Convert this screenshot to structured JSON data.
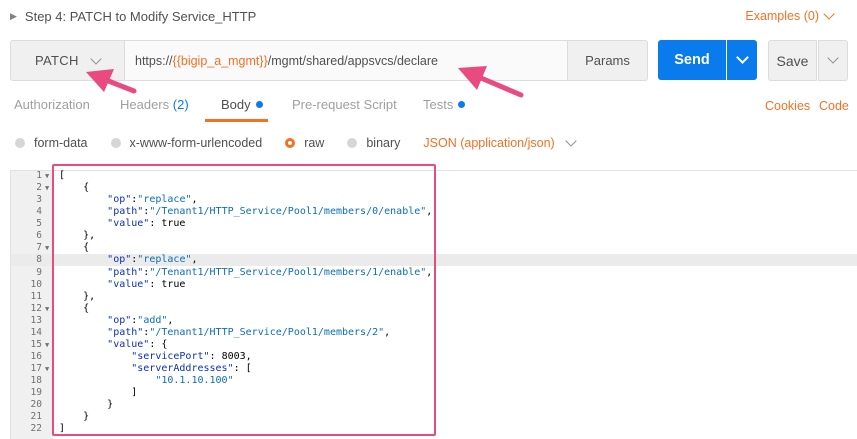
{
  "request": {
    "title": "Step 4: PATCH to Modify Service_HTTP",
    "examples_label": "Examples (0)"
  },
  "url_bar": {
    "method": "PATCH",
    "url_prefix": "https://",
    "url_variable": "{{bigip_a_mgmt}}",
    "url_suffix": "/mgmt/shared/appsvcs/declare",
    "params_label": "Params",
    "send_label": "Send",
    "save_label": "Save"
  },
  "tabs": [
    {
      "label": "Authorization"
    },
    {
      "label": "Headers",
      "count": "(2)"
    },
    {
      "label": "Body",
      "active": true
    },
    {
      "label": "Pre-request Script"
    },
    {
      "label": "Tests"
    }
  ],
  "right_links": {
    "cookies": "Cookies",
    "code": "Code"
  },
  "body_types": {
    "options": [
      "form-data",
      "x-www-form-urlencoded",
      "raw",
      "binary"
    ],
    "selected": "raw",
    "content_type": "JSON (application/json)"
  },
  "editor": {
    "line_numbers": [
      "1",
      "2",
      "3",
      "4",
      "5",
      "6",
      "7",
      "8",
      "9",
      "10",
      "11",
      "12",
      "13",
      "14",
      "15",
      "16",
      "17",
      "18",
      "19",
      "20",
      "21",
      "22"
    ],
    "lines": [
      "[",
      "    {",
      "        \"op\":\"replace\",",
      "        \"path\":\"/Tenant1/HTTP_Service/Pool1/members/0/enable\",",
      "        \"value\": true",
      "    },",
      "    {",
      "        \"op\":\"replace\",",
      "        \"path\":\"/Tenant1/HTTP_Service/Pool1/members/1/enable\",",
      "        \"value\": true",
      "    },",
      "    {",
      "        \"op\":\"add\",",
      "        \"path\":\"/Tenant1/HTTP_Service/Pool1/members/2\",",
      "        \"value\": {",
      "            \"servicePort\": 8003,",
      "            \"serverAddresses\": [",
      "                \"10.1.10.100\"",
      "            ]",
      "        }",
      "    }",
      "]"
    ],
    "highlighted_line": 8
  },
  "colors": {
    "accent_orange": "#f47023",
    "send_blue": "#097bed",
    "annotation_pink": "#e94a7f"
  }
}
